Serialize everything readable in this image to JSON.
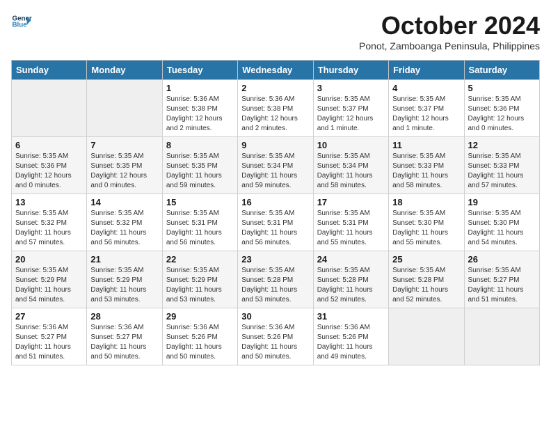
{
  "header": {
    "logo": {
      "line1": "General",
      "line2": "Blue"
    },
    "title": "October 2024",
    "subtitle": "Ponot, Zamboanga Peninsula, Philippines"
  },
  "days_of_week": [
    "Sunday",
    "Monday",
    "Tuesday",
    "Wednesday",
    "Thursday",
    "Friday",
    "Saturday"
  ],
  "weeks": [
    [
      {
        "day": "",
        "content": ""
      },
      {
        "day": "",
        "content": ""
      },
      {
        "day": "1",
        "content": "Sunrise: 5:36 AM\nSunset: 5:38 PM\nDaylight: 12 hours and 2 minutes."
      },
      {
        "day": "2",
        "content": "Sunrise: 5:36 AM\nSunset: 5:38 PM\nDaylight: 12 hours and 2 minutes."
      },
      {
        "day": "3",
        "content": "Sunrise: 5:35 AM\nSunset: 5:37 PM\nDaylight: 12 hours and 1 minute."
      },
      {
        "day": "4",
        "content": "Sunrise: 5:35 AM\nSunset: 5:37 PM\nDaylight: 12 hours and 1 minute."
      },
      {
        "day": "5",
        "content": "Sunrise: 5:35 AM\nSunset: 5:36 PM\nDaylight: 12 hours and 0 minutes."
      }
    ],
    [
      {
        "day": "6",
        "content": "Sunrise: 5:35 AM\nSunset: 5:36 PM\nDaylight: 12 hours and 0 minutes."
      },
      {
        "day": "7",
        "content": "Sunrise: 5:35 AM\nSunset: 5:35 PM\nDaylight: 12 hours and 0 minutes."
      },
      {
        "day": "8",
        "content": "Sunrise: 5:35 AM\nSunset: 5:35 PM\nDaylight: 11 hours and 59 minutes."
      },
      {
        "day": "9",
        "content": "Sunrise: 5:35 AM\nSunset: 5:34 PM\nDaylight: 11 hours and 59 minutes."
      },
      {
        "day": "10",
        "content": "Sunrise: 5:35 AM\nSunset: 5:34 PM\nDaylight: 11 hours and 58 minutes."
      },
      {
        "day": "11",
        "content": "Sunrise: 5:35 AM\nSunset: 5:33 PM\nDaylight: 11 hours and 58 minutes."
      },
      {
        "day": "12",
        "content": "Sunrise: 5:35 AM\nSunset: 5:33 PM\nDaylight: 11 hours and 57 minutes."
      }
    ],
    [
      {
        "day": "13",
        "content": "Sunrise: 5:35 AM\nSunset: 5:32 PM\nDaylight: 11 hours and 57 minutes."
      },
      {
        "day": "14",
        "content": "Sunrise: 5:35 AM\nSunset: 5:32 PM\nDaylight: 11 hours and 56 minutes."
      },
      {
        "day": "15",
        "content": "Sunrise: 5:35 AM\nSunset: 5:31 PM\nDaylight: 11 hours and 56 minutes."
      },
      {
        "day": "16",
        "content": "Sunrise: 5:35 AM\nSunset: 5:31 PM\nDaylight: 11 hours and 56 minutes."
      },
      {
        "day": "17",
        "content": "Sunrise: 5:35 AM\nSunset: 5:31 PM\nDaylight: 11 hours and 55 minutes."
      },
      {
        "day": "18",
        "content": "Sunrise: 5:35 AM\nSunset: 5:30 PM\nDaylight: 11 hours and 55 minutes."
      },
      {
        "day": "19",
        "content": "Sunrise: 5:35 AM\nSunset: 5:30 PM\nDaylight: 11 hours and 54 minutes."
      }
    ],
    [
      {
        "day": "20",
        "content": "Sunrise: 5:35 AM\nSunset: 5:29 PM\nDaylight: 11 hours and 54 minutes."
      },
      {
        "day": "21",
        "content": "Sunrise: 5:35 AM\nSunset: 5:29 PM\nDaylight: 11 hours and 53 minutes."
      },
      {
        "day": "22",
        "content": "Sunrise: 5:35 AM\nSunset: 5:29 PM\nDaylight: 11 hours and 53 minutes."
      },
      {
        "day": "23",
        "content": "Sunrise: 5:35 AM\nSunset: 5:28 PM\nDaylight: 11 hours and 53 minutes."
      },
      {
        "day": "24",
        "content": "Sunrise: 5:35 AM\nSunset: 5:28 PM\nDaylight: 11 hours and 52 minutes."
      },
      {
        "day": "25",
        "content": "Sunrise: 5:35 AM\nSunset: 5:28 PM\nDaylight: 11 hours and 52 minutes."
      },
      {
        "day": "26",
        "content": "Sunrise: 5:35 AM\nSunset: 5:27 PM\nDaylight: 11 hours and 51 minutes."
      }
    ],
    [
      {
        "day": "27",
        "content": "Sunrise: 5:36 AM\nSunset: 5:27 PM\nDaylight: 11 hours and 51 minutes."
      },
      {
        "day": "28",
        "content": "Sunrise: 5:36 AM\nSunset: 5:27 PM\nDaylight: 11 hours and 50 minutes."
      },
      {
        "day": "29",
        "content": "Sunrise: 5:36 AM\nSunset: 5:26 PM\nDaylight: 11 hours and 50 minutes."
      },
      {
        "day": "30",
        "content": "Sunrise: 5:36 AM\nSunset: 5:26 PM\nDaylight: 11 hours and 50 minutes."
      },
      {
        "day": "31",
        "content": "Sunrise: 5:36 AM\nSunset: 5:26 PM\nDaylight: 11 hours and 49 minutes."
      },
      {
        "day": "",
        "content": ""
      },
      {
        "day": "",
        "content": ""
      }
    ]
  ]
}
